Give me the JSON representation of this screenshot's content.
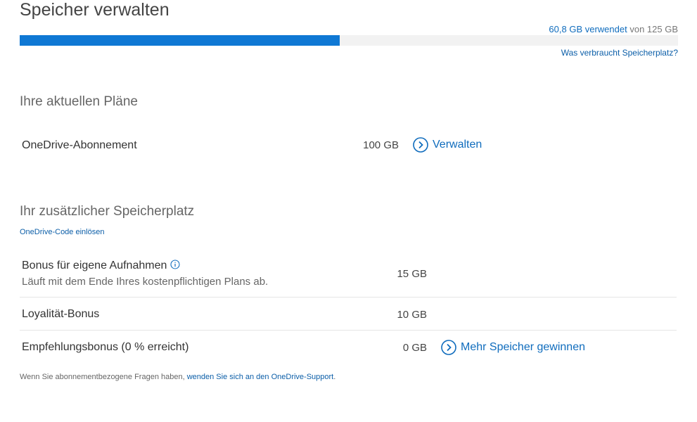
{
  "page_title": "Speicher verwalten",
  "usage": {
    "used_text": "60,8 GB verwendet",
    "total_text": "von 125 GB",
    "fraction_used": 0.486,
    "what_link": "Was verbraucht Speicherplatz?",
    "bar_color": "#0f78d4"
  },
  "plans": {
    "heading": "Ihre aktuellen Pläne",
    "items": [
      {
        "name": "OneDrive-Abonnement",
        "size": "100 GB",
        "action_label": "Verwalten",
        "action_icon": "chevron-circle-right-icon"
      }
    ]
  },
  "extra": {
    "heading": "Ihr zusätzlicher Speicherplatz",
    "redeem_link": "OneDrive-Code einlösen",
    "rows": [
      {
        "title": "Bonus für eigene Aufnahmen",
        "subtitle": "Läuft mit dem Ende Ihres kostenpflichtigen Plans ab.",
        "size": "15 GB",
        "info_icon": "info-icon"
      },
      {
        "title": "Loyalität-Bonus",
        "size": "10 GB"
      },
      {
        "title": "Empfehlungsbonus (0 % erreicht)",
        "size": "0 GB",
        "action_label": "Mehr Speicher gewinnen",
        "action_icon": "chevron-circle-right-icon"
      }
    ]
  },
  "footer": {
    "text": "Wenn Sie abonnementbezogene Fragen haben,",
    "link": "wenden Sie sich an den OneDrive-Support",
    "end": "."
  },
  "colors": {
    "accent": "#0f6cbd",
    "link": "#0b5ea8"
  }
}
